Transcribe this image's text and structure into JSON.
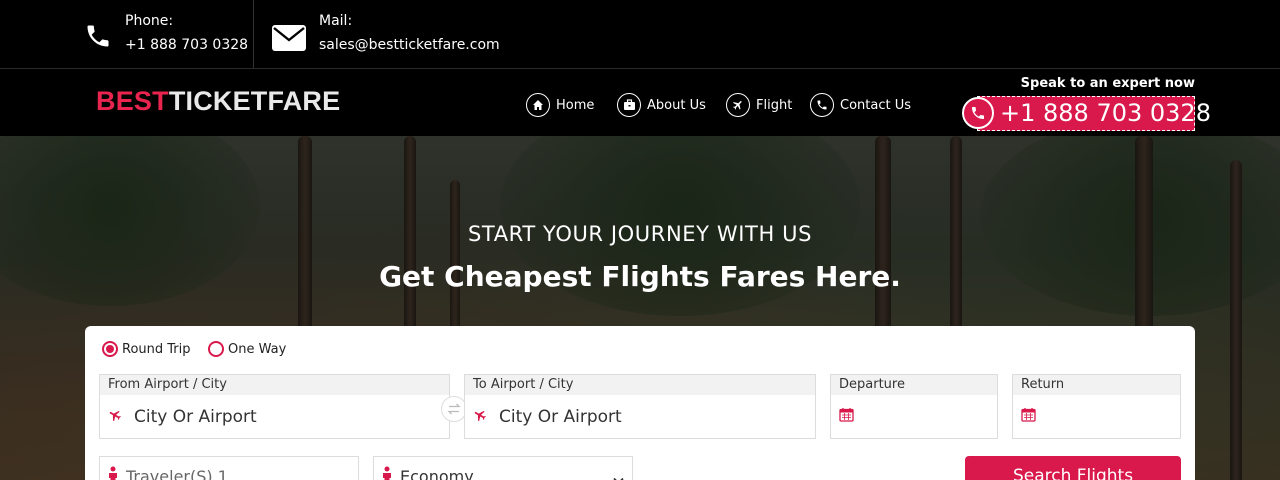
{
  "topbar": {
    "phone_label": "Phone:",
    "phone_value": "+1 888 703 0328",
    "mail_label": "Mail:",
    "mail_value": "sales@bestticketfare.com"
  },
  "brand": {
    "part1": "BEST",
    "part2": "TICKETFARE"
  },
  "nav": {
    "items": [
      {
        "label": "Home",
        "icon": "home-icon"
      },
      {
        "label": "About Us",
        "icon": "briefcase-icon"
      },
      {
        "label": "Flight",
        "icon": "plane-icon"
      },
      {
        "label": "Contact Us",
        "icon": "phone-icon"
      }
    ],
    "speak_text": "Speak to an expert now",
    "hotline": "+1 888 703 0328"
  },
  "hero": {
    "subtitle": "START YOUR JOURNEY WITH US",
    "title": "Get Cheapest Flights Fares Here."
  },
  "search": {
    "trip_types": [
      {
        "label": "Round Trip",
        "selected": true
      },
      {
        "label": "One Way",
        "selected": false
      }
    ],
    "from_label": "From Airport / City",
    "from_placeholder": "City Or Airport",
    "to_label": "To Airport / City",
    "to_placeholder": "City Or Airport",
    "departure_label": "Departure",
    "return_label": "Return",
    "travelers_placeholder": "Traveler(S) 1",
    "cabin_value": "Economy",
    "submit_label": "Search Flights"
  },
  "colors": {
    "accent": "#d9184b",
    "topbar_bg": "#000000",
    "panel_bg": "#ffffff"
  }
}
